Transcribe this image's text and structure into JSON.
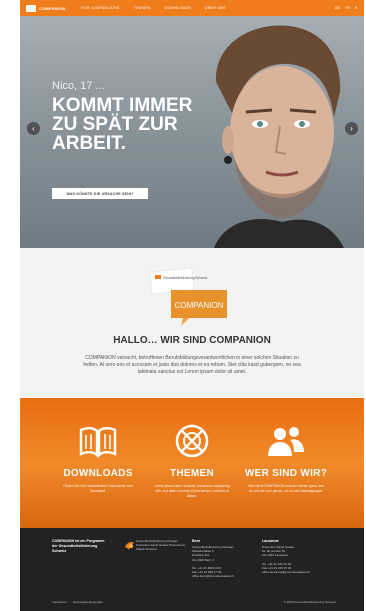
{
  "nav": {
    "logo_text": "COMPANION",
    "items": [
      "FÜR JUGENDLICHE",
      "THEMEN",
      "DOWNLOADS",
      "ÜBER UNS"
    ],
    "languages": [
      "DE",
      "FR",
      "IT"
    ]
  },
  "hero": {
    "kicker": "Nico, 17 ...",
    "title": "KOMMT IMMER ZU SPÄT ZUR ARBEIT.",
    "button_label": "WAS KÖNNTE DIE URSACHE SEIN?",
    "prev_icon": "chevron-left-icon",
    "next_icon": "chevron-right-icon"
  },
  "about": {
    "badge_small": "Gesundheitsförderung Schweiz",
    "badge_large": "COMPANION",
    "title": "HALLO… WIR SIND COMPANION",
    "body": "COMPANION versucht, betroffenen Berufsbildungsverantwortlichen in einer solchen Situation zu helfen. At vero eos et accusam et justo duo dolores et ea rebum. Stet clita kasd gubergren, no sea takimata sanctus est Lorem ipsum dolor sit amet."
  },
  "features": [
    {
      "icon": "book-icon",
      "title": "DOWNLOADS",
      "text": "Finden Sie hier verschiedene Dokumente zum Download."
    },
    {
      "icon": "themes-icon",
      "title": "THEMEN",
      "text": "Lorem ipsum dolor sit amet, consetetur sadipscing elitr, sed diam nonumy eirmod tempor invidunt ut labore."
    },
    {
      "icon": "people-icon",
      "title": "WER SIND WIR?",
      "text": "Wer steht COMPANION und wer stehen ganz, wer ist und wer wer genau, sie ist eine Arbeitsgruppe."
    }
  ],
  "footer": {
    "program": "COMPANION ist ein Programm der Gesundheitsförderung Schweiz",
    "logo_text": "Gesundheitsförderung Schweiz Promotion Santé Suisse Promozione Salute Svizzera",
    "bern": {
      "title": "Bern",
      "lines": [
        "Gesundheitsförderung Schweiz",
        "Wankdorfallee 5",
        "Postfach 311",
        "CH-3000 Bern 4"
      ],
      "contact": [
        "Tel. +41 31 350 04 04",
        "Fax +41 31 368 17 00",
        "office.bern@promotionsante.ch"
      ]
    },
    "lausanne": {
      "title": "Lausanne",
      "lines": [
        "Promotion Santé Suisse",
        "Av. de la Gare 52",
        "CH-1003 Lausanne"
      ],
      "contact": [
        "Tel. +41 21 345 15 15",
        "Fax +41 21 345 15 45",
        "office.lausanne@promotionsante.ch"
      ]
    },
    "links": [
      "Impressum",
      "Nutzungsbedingungen"
    ],
    "copyright": "© 2015 Gesundheitsförderung Schweiz"
  },
  "colors": {
    "accent": "#f07d1b",
    "footer": "#222222",
    "about_bg": "#f3f3f3"
  }
}
